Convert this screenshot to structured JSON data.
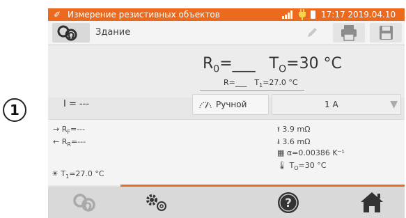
{
  "callout": {
    "number": "1"
  },
  "status": {
    "title": "Измерение резистивных объектов",
    "datetime": "17:17 2019.04.10"
  },
  "toolbar": {
    "object_name": "Здание"
  },
  "results": {
    "r0_label": "R",
    "r0_sub": "0",
    "r0_value": "=___",
    "t0_label": "T",
    "t0_sub": "O",
    "t0_value": "=30 °C",
    "r_value": "R=___",
    "t1_value": "T",
    "t1_sub": "1",
    "t1_rest": "=27.0 °C"
  },
  "controls": {
    "current": "I = ---",
    "mode": "Ручной",
    "range": "1 A"
  },
  "details": {
    "rf": "R",
    "rf_sub": "F",
    "rf_val": "=---",
    "rr": "R",
    "rr_sub": "R",
    "rr_val": "=---",
    "t1": "T",
    "t1_sub": "1",
    "t1_val": "=27.0 °C",
    "up_val": "3.9 mΩ",
    "down_val": "3.6 mΩ",
    "alpha": "α=0.00386 K⁻¹",
    "t0": "T",
    "t0_sub": "O",
    "t0_val": "=30 °C"
  },
  "colors": {
    "accent": "#ec6a1e",
    "icon_dark": "#2f2f2f",
    "icon_light": "#a9a9a9"
  }
}
